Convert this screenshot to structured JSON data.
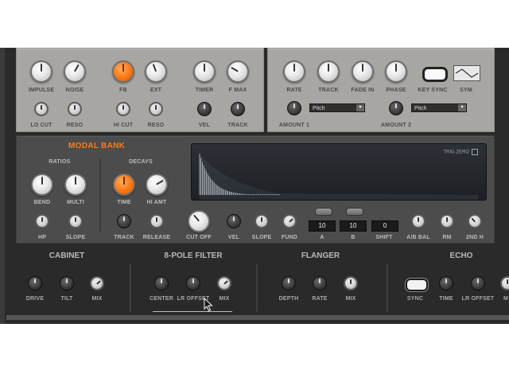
{
  "top_left_panel": {
    "row1": [
      "IMPULSE",
      "NOISE",
      "FB",
      "EXT",
      "TIMER",
      "F MAX"
    ],
    "row2": [
      "LO CUT",
      "RESO",
      "HI CUT",
      "RESO",
      "VEL",
      "TRACK"
    ]
  },
  "top_right_panel": {
    "row1": [
      "RATE",
      "TRACK",
      "FADE IN",
      "PHASE",
      "KEY SYNC",
      "SYM"
    ],
    "amount1": "AMOUNT 1",
    "amount2": "AMOUNT 2",
    "dropdown1": "Pitch",
    "dropdown2": "Pitch"
  },
  "modal_bank": {
    "title": "MODAL BANK",
    "ratios_label": "RATIOS",
    "decays_label": "DECAYS",
    "row1": [
      "BEND",
      "MULTI",
      "TIME",
      "HI AMT"
    ],
    "row2": [
      "HP",
      "SLOPE",
      "TRACK",
      "RELEASE",
      "CUT OFF",
      "VEL",
      "SLOPE",
      "FUND"
    ],
    "trig_zero": "TRIG ZERO",
    "value_a": "10",
    "value_b": "10",
    "value_shift": "0",
    "label_a": "A",
    "label_b": "B",
    "label_shift": "SHIFT",
    "right_labels": [
      "A/B BAL",
      "RM",
      "2ND H"
    ]
  },
  "fx_sections": {
    "cabinet": {
      "title": "CABINET",
      "labels": [
        "DRIVE",
        "TILT",
        "MIX"
      ]
    },
    "filter": {
      "title": "8-POLE FILTER",
      "labels": [
        "CENTER",
        "LR OFFSET",
        "MIX"
      ]
    },
    "flanger": {
      "title": "FLANGER",
      "labels": [
        "DEPTH",
        "RATE",
        "MIX"
      ]
    },
    "echo": {
      "title": "ECHO",
      "labels": [
        "SYNC",
        "TIME",
        "LR OFFSET",
        "M"
      ]
    }
  },
  "colors": {
    "accent": "#ff7a1a",
    "panel": "#a7a6a2",
    "dark_panel": "#4c4c4c",
    "background": "#2a2a2a"
  }
}
